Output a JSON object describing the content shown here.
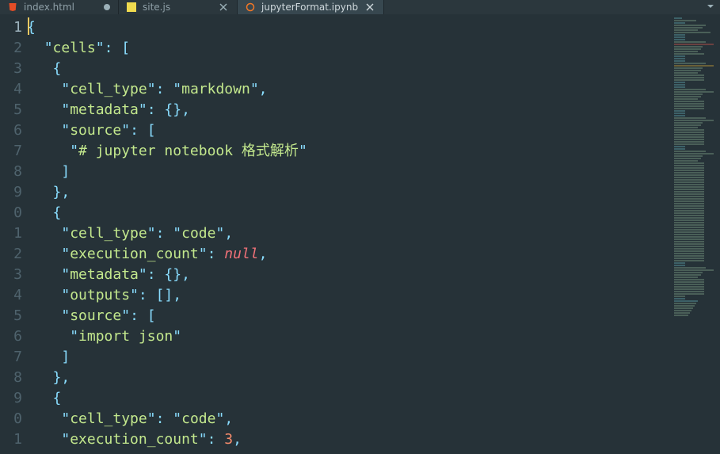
{
  "tabs": [
    {
      "label": "index.html",
      "dirty": true,
      "active": false
    },
    {
      "label": "site.js",
      "dirty": false,
      "active": false
    },
    {
      "label": "jupyterFormat.ipynb",
      "dirty": false,
      "active": true
    }
  ],
  "colors": {
    "bg": "#263238",
    "tab_active_bg": "#37474f",
    "tab_bg": "#2b373d",
    "punct": "#89ddff",
    "string": "#c3e88d",
    "null": "#f07178",
    "number": "#f78c6c",
    "gutter": "#4f636d",
    "gutter_current": "#9db3bd"
  },
  "icons": {
    "tab0": "file-html-icon",
    "tab1": "file-js-icon",
    "tab2": "file-jupyter-icon",
    "corner": "chevron-down-icon"
  },
  "gutter": [
    "1",
    "2",
    "3",
    "4",
    "5",
    "6",
    "7",
    "8",
    "9",
    "0",
    "1",
    "2",
    "3",
    "4",
    "5",
    "6",
    "7",
    "8",
    "9",
    "0",
    "1"
  ],
  "active_line": 1,
  "code": {
    "l1": [
      {
        "cls": "p",
        "t": "{"
      }
    ],
    "l2": [
      {
        "cls": "",
        "t": "  "
      },
      {
        "cls": "p",
        "t": "\""
      },
      {
        "cls": "sk",
        "t": "cells"
      },
      {
        "cls": "p",
        "t": "\""
      },
      {
        "cls": "p",
        "t": ": ["
      }
    ],
    "l3": [
      {
        "cls": "",
        "t": "   "
      },
      {
        "cls": "p",
        "t": "{"
      }
    ],
    "l4": [
      {
        "cls": "",
        "t": "    "
      },
      {
        "cls": "p",
        "t": "\""
      },
      {
        "cls": "sk",
        "t": "cell_type"
      },
      {
        "cls": "p",
        "t": "\""
      },
      {
        "cls": "p",
        "t": ": "
      },
      {
        "cls": "p",
        "t": "\""
      },
      {
        "cls": "sv",
        "t": "markdown"
      },
      {
        "cls": "p",
        "t": "\""
      },
      {
        "cls": "p",
        "t": ","
      }
    ],
    "l5": [
      {
        "cls": "",
        "t": "    "
      },
      {
        "cls": "p",
        "t": "\""
      },
      {
        "cls": "sk",
        "t": "metadata"
      },
      {
        "cls": "p",
        "t": "\""
      },
      {
        "cls": "p",
        "t": ": {},"
      }
    ],
    "l6": [
      {
        "cls": "",
        "t": "    "
      },
      {
        "cls": "p",
        "t": "\""
      },
      {
        "cls": "sk",
        "t": "source"
      },
      {
        "cls": "p",
        "t": "\""
      },
      {
        "cls": "p",
        "t": ": ["
      }
    ],
    "l7": [
      {
        "cls": "",
        "t": "     "
      },
      {
        "cls": "p",
        "t": "\""
      },
      {
        "cls": "sv",
        "t": "# jupyter notebook 格式解析"
      },
      {
        "cls": "p",
        "t": "\""
      }
    ],
    "l8": [
      {
        "cls": "",
        "t": "    "
      },
      {
        "cls": "p",
        "t": "]"
      }
    ],
    "l9": [
      {
        "cls": "",
        "t": "   "
      },
      {
        "cls": "p",
        "t": "},"
      }
    ],
    "l10": [
      {
        "cls": "",
        "t": "   "
      },
      {
        "cls": "p",
        "t": "{"
      }
    ],
    "l11": [
      {
        "cls": "",
        "t": "    "
      },
      {
        "cls": "p",
        "t": "\""
      },
      {
        "cls": "sk",
        "t": "cell_type"
      },
      {
        "cls": "p",
        "t": "\""
      },
      {
        "cls": "p",
        "t": ": "
      },
      {
        "cls": "p",
        "t": "\""
      },
      {
        "cls": "sv",
        "t": "code"
      },
      {
        "cls": "p",
        "t": "\""
      },
      {
        "cls": "p",
        "t": ","
      }
    ],
    "l12": [
      {
        "cls": "",
        "t": "    "
      },
      {
        "cls": "p",
        "t": "\""
      },
      {
        "cls": "sk",
        "t": "execution_count"
      },
      {
        "cls": "p",
        "t": "\""
      },
      {
        "cls": "p",
        "t": ": "
      },
      {
        "cls": "nul",
        "t": "null"
      },
      {
        "cls": "p",
        "t": ","
      }
    ],
    "l13": [
      {
        "cls": "",
        "t": "    "
      },
      {
        "cls": "p",
        "t": "\""
      },
      {
        "cls": "sk",
        "t": "metadata"
      },
      {
        "cls": "p",
        "t": "\""
      },
      {
        "cls": "p",
        "t": ": {},"
      }
    ],
    "l14": [
      {
        "cls": "",
        "t": "    "
      },
      {
        "cls": "p",
        "t": "\""
      },
      {
        "cls": "sk",
        "t": "outputs"
      },
      {
        "cls": "p",
        "t": "\""
      },
      {
        "cls": "p",
        "t": ": [],"
      }
    ],
    "l15": [
      {
        "cls": "",
        "t": "    "
      },
      {
        "cls": "p",
        "t": "\""
      },
      {
        "cls": "sk",
        "t": "source"
      },
      {
        "cls": "p",
        "t": "\""
      },
      {
        "cls": "p",
        "t": ": ["
      }
    ],
    "l16": [
      {
        "cls": "",
        "t": "     "
      },
      {
        "cls": "p",
        "t": "\""
      },
      {
        "cls": "sv",
        "t": "import json"
      },
      {
        "cls": "p",
        "t": "\""
      }
    ],
    "l17": [
      {
        "cls": "",
        "t": "    "
      },
      {
        "cls": "p",
        "t": "]"
      }
    ],
    "l18": [
      {
        "cls": "",
        "t": "   "
      },
      {
        "cls": "p",
        "t": "},"
      }
    ],
    "l19": [
      {
        "cls": "",
        "t": "   "
      },
      {
        "cls": "p",
        "t": "{"
      }
    ],
    "l20": [
      {
        "cls": "",
        "t": "    "
      },
      {
        "cls": "p",
        "t": "\""
      },
      {
        "cls": "sk",
        "t": "cell_type"
      },
      {
        "cls": "p",
        "t": "\""
      },
      {
        "cls": "p",
        "t": ": "
      },
      {
        "cls": "p",
        "t": "\""
      },
      {
        "cls": "sv",
        "t": "code"
      },
      {
        "cls": "p",
        "t": "\""
      },
      {
        "cls": "p",
        "t": ","
      }
    ],
    "l21": [
      {
        "cls": "",
        "t": "    "
      },
      {
        "cls": "p",
        "t": "\""
      },
      {
        "cls": "sk",
        "t": "execution_count"
      },
      {
        "cls": "p",
        "t": "\""
      },
      {
        "cls": "p",
        "t": ": "
      },
      {
        "cls": "num",
        "t": "3"
      },
      {
        "cls": "p",
        "t": ","
      }
    ]
  }
}
